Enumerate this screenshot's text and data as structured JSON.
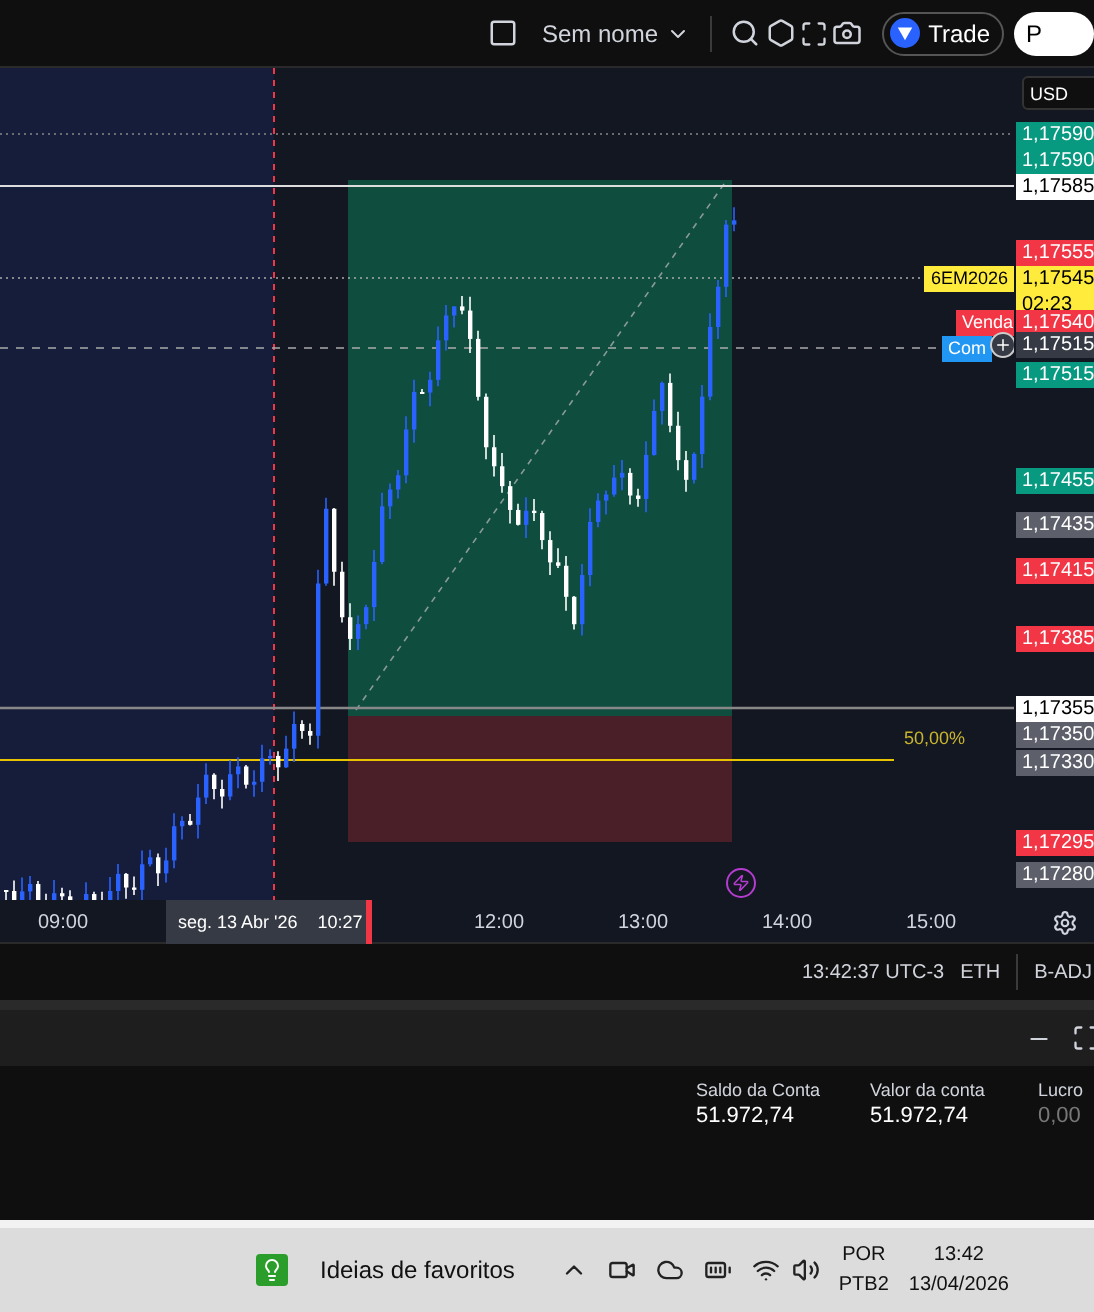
{
  "toolbar": {
    "layout_name": "Sem nome",
    "trade_button": "Trade",
    "profile_button": "P"
  },
  "price_axis": {
    "currency": "USD",
    "labels": [
      {
        "text": "1,17590",
        "color": "#089981"
      },
      {
        "text": "1,17590",
        "color": "#089981"
      },
      {
        "text": "1,17585",
        "color": "#ffffff"
      },
      {
        "text": "1,17555",
        "color": "#f23645"
      },
      {
        "text": "1,17545",
        "color": "#ffeb3b",
        "countdown": "02:23"
      },
      {
        "text": "1,17540",
        "color": "#f23645"
      },
      {
        "text": "1,17515",
        "color": "#363a45"
      },
      {
        "text": "1,17515",
        "color": "#089981"
      },
      {
        "text": "1,17455",
        "color": "#089981"
      },
      {
        "text": "1,17435",
        "color": "#5d606b"
      },
      {
        "text": "1,17415",
        "color": "#f23645"
      },
      {
        "text": "1,17385",
        "color": "#f23645"
      },
      {
        "text": "1,17355",
        "color": "#ffffff"
      },
      {
        "text": "1,17350",
        "color": "#5d606b"
      },
      {
        "text": "1,17330",
        "color": "#5d606b"
      },
      {
        "text": "1,17295",
        "color": "#f23645"
      },
      {
        "text": "1,17280",
        "color": "#5d606b"
      }
    ]
  },
  "chart": {
    "symbol_tag": "6EM2026",
    "sell_tag": "Venda",
    "buy_tag": "Com",
    "fib_label": "50,00%"
  },
  "time_axis": {
    "ticks": [
      "09:00",
      "12:00",
      "13:00",
      "14:00",
      "15:00"
    ],
    "cursor_date": "seg. 13 Abr '26",
    "cursor_time": "10:27"
  },
  "status_bar": {
    "time": "13:42:37 UTC-3",
    "session": "ETH",
    "adjustment": "B-ADJ"
  },
  "account": [
    {
      "label": "Saldo da Conta",
      "value": "51.972,74",
      "muted": false
    },
    {
      "label": "Valor da conta",
      "value": "51.972,74",
      "muted": false
    },
    {
      "label": "Lucro",
      "value": "0,00",
      "muted": true
    }
  ],
  "taskbar": {
    "widget": "Ideias de favoritos",
    "language": "POR",
    "layout": "PTB2",
    "time": "13:42",
    "date": "13/04/2026"
  }
}
